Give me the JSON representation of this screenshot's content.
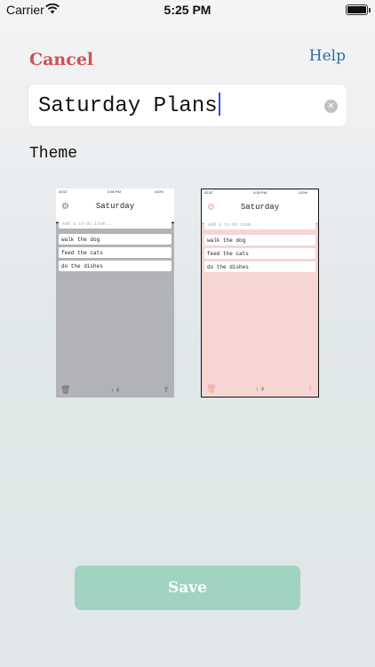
{
  "status_bar": {
    "carrier": "Carrier",
    "time": "5:25 PM"
  },
  "nav": {
    "cancel_label": "Cancel",
    "help_label": "Help"
  },
  "title_field": {
    "value": "Saturday Plans"
  },
  "theme_section": {
    "label": "Theme"
  },
  "themes": [
    {
      "name": "gray",
      "preview": {
        "carrier": "AT&T",
        "time": "3:56 PM",
        "battery": "100%",
        "title": "Saturday",
        "add_placeholder": "Add a to-do item...",
        "items": [
          "walk the dog",
          "feed the cats",
          "do the dishes"
        ],
        "count": "↕ 2"
      },
      "colors": {
        "background": "#b2b3b7"
      }
    },
    {
      "name": "pink",
      "preview": {
        "carrier": "AT&T",
        "time": "4:05 PM",
        "battery": "100%",
        "title": "Saturday",
        "add_placeholder": "Add a to-do item...",
        "items": [
          "walk the dog",
          "feed the cats",
          "do the dishes"
        ],
        "count": "↕ 2"
      },
      "colors": {
        "background": "#f7d5d3"
      }
    }
  ],
  "save_button": {
    "label": "Save",
    "color": "#a0d4c0"
  },
  "colors": {
    "cancel": "#d2504f",
    "help": "#2f6fa6",
    "caret": "#2a4fd6"
  },
  "icons": {
    "clear": "clear-icon",
    "gear": "gear-icon",
    "trash": "trash-icon",
    "share": "share-icon",
    "wifi": "wifi-icon",
    "battery": "battery-icon"
  }
}
